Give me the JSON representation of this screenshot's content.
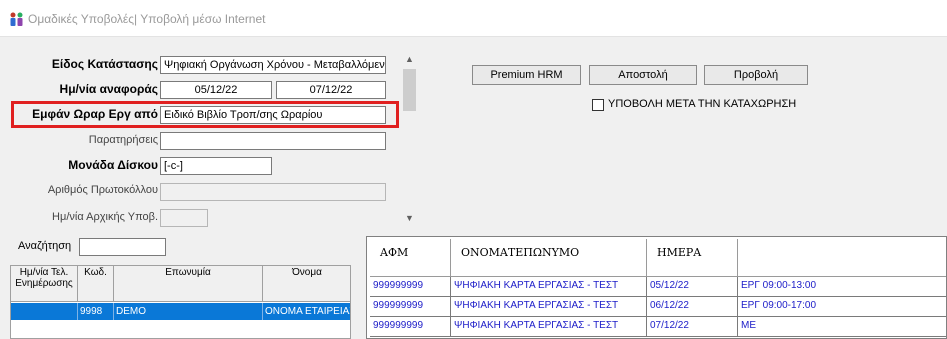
{
  "window": {
    "title": "Ομαδικές Υποβολές| Υποβολή μέσω Internet",
    "icon": "app-people-icon"
  },
  "form": {
    "eidos_label": "Είδος Κατάστασης",
    "eidos_value": "Ψηφιακή Οργάνωση Χρόνου - Μεταβαλλόμενι",
    "date_label": "Ημ/νία αναφοράς",
    "date_from": "05/12/22",
    "date_to": "07/12/22",
    "emfan_label": "Εμφάν Ωραρ Εργ από",
    "emfan_value": "Ειδικό Βιβλίο Τροπ/σης Ωραρίου",
    "parat_label": "Παρατηρήσεις",
    "parat_value": "",
    "monada_label": "Μονάδα Δίσκου",
    "monada_value": "[-c-]",
    "protokollo_label": "Αριθμός Πρωτοκόλλου",
    "protokollo_value": "",
    "arxiki_label": "Ημ/νία Αρχικής Υποβ.",
    "arxiki_value": ""
  },
  "buttons": {
    "premium": "Premium HRM",
    "apostoli": "Αποστολή",
    "provoli": "Προβολή"
  },
  "checkbox": {
    "label": "ΥΠΟΒΟΛΗ ΜΕΤΑ ΤΗΝ ΚΑΤΑΧΩΡΗΣΗ",
    "checked": false
  },
  "search": {
    "label": "Αναζήτηση",
    "value": ""
  },
  "left_grid": {
    "headers": [
      "Ημ/νία Τελ. Ενημέρωσης",
      "Κωδ.",
      "Επωνυμία",
      "Όνομα"
    ],
    "rows": [
      {
        "date": "",
        "code": "9998",
        "name": "DEMO",
        "onoma": "ΟΝΟΜΑ ΕΤΑΙΡΕΙΑΣ"
      }
    ]
  },
  "right_grid": {
    "headers": [
      "ΑΦΜ",
      "ΟΝΟΜΑΤΕΠΩΝΥΜΟ",
      "ΗΜΕΡΑ",
      ""
    ],
    "rows": [
      {
        "afm": "999999999",
        "onoma": "ΨΗΦΙΑΚΗ ΚΑΡΤΑ ΕΡΓΑΣΙΑΣ - ΤΕΣΤ",
        "imera": "05/12/22",
        "info": "ΕΡΓ 09:00-13:00"
      },
      {
        "afm": "999999999",
        "onoma": "ΨΗΦΙΑΚΗ ΚΑΡΤΑ ΕΡΓΑΣΙΑΣ - ΤΕΣΤ",
        "imera": "06/12/22",
        "info": "ΕΡΓ 09:00-17:00"
      },
      {
        "afm": "999999999",
        "onoma": "ΨΗΦΙΑΚΗ ΚΑΡΤΑ ΕΡΓΑΣΙΑΣ - ΤΕΣΤ",
        "imera": "07/12/22",
        "info": "ΜΕ"
      }
    ]
  },
  "colors": {
    "highlight": "#e02020",
    "selection": "#0a78d7",
    "grid_text": "#1c1cc8"
  }
}
